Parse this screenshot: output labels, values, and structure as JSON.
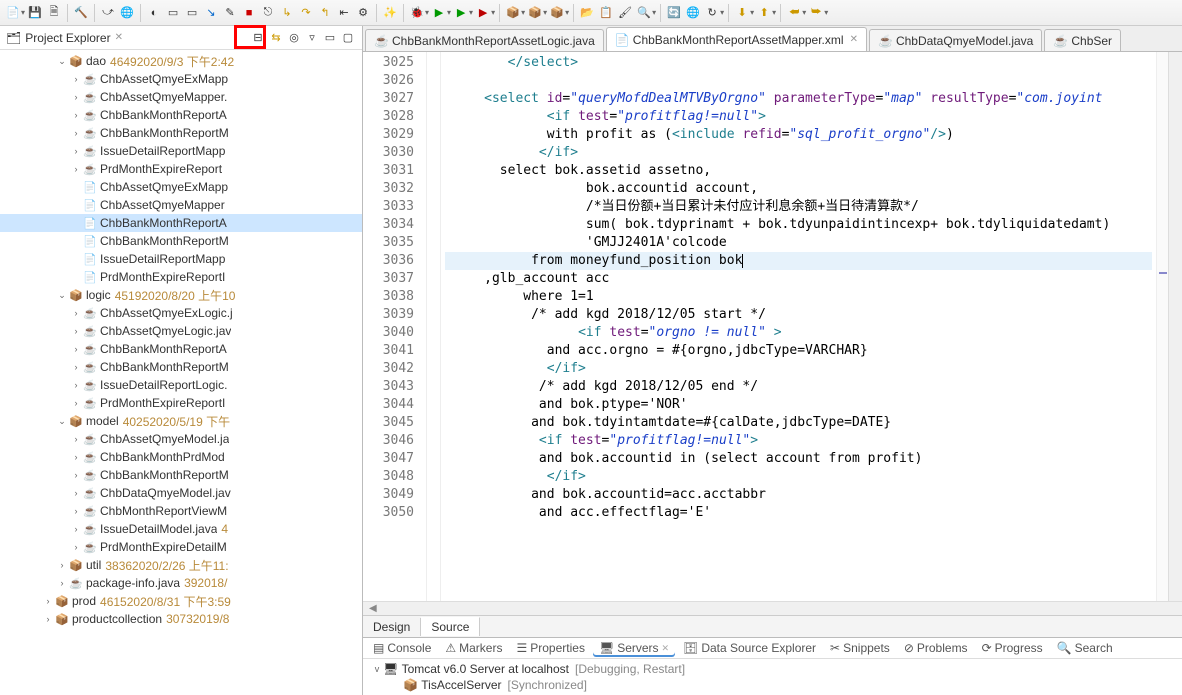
{
  "toolbar_icons": [
    "new",
    "save",
    "save-all",
    "print",
    "build",
    "skip",
    "globe",
    "toggle",
    "panel1",
    "panel2",
    "cursor",
    "edit",
    "stop",
    "redo",
    "next",
    "find",
    "wrench",
    "wand",
    "star",
    "bug",
    "run",
    "ext",
    "pkg",
    "new-pkg",
    "cls",
    "folder",
    "open",
    "brush",
    "sync",
    "web",
    "rotate",
    "down",
    "up",
    "back",
    "fwd"
  ],
  "project_explorer": {
    "title": "Project Explorer",
    "tree": [
      {
        "d": 4,
        "tw": "v",
        "ic": "pk",
        "label": "dao",
        "meta": "46492020/9/3 下午2:42"
      },
      {
        "d": 5,
        "tw": ">",
        "ic": "ju",
        "label": "ChbAssetQmyeExMapp"
      },
      {
        "d": 5,
        "tw": ">",
        "ic": "ju",
        "label": "ChbAssetQmyeMapper."
      },
      {
        "d": 5,
        "tw": ">",
        "ic": "ju",
        "label": "ChbBankMonthReportA"
      },
      {
        "d": 5,
        "tw": ">",
        "ic": "ju",
        "label": "ChbBankMonthReportM"
      },
      {
        "d": 5,
        "tw": ">",
        "ic": "ju",
        "label": "IssueDetailReportMapp"
      },
      {
        "d": 5,
        "tw": ">",
        "ic": "ju",
        "label": "PrdMonthExpireReport"
      },
      {
        "d": 5,
        "tw": "",
        "ic": "xm",
        "label": "ChbAssetQmyeExMapp"
      },
      {
        "d": 5,
        "tw": "",
        "ic": "xm",
        "label": "ChbAssetQmyeMapper"
      },
      {
        "d": 5,
        "tw": "",
        "ic": "xm",
        "label": "ChbBankMonthReportA",
        "sel": true
      },
      {
        "d": 5,
        "tw": "",
        "ic": "xm",
        "label": "ChbBankMonthReportM"
      },
      {
        "d": 5,
        "tw": "",
        "ic": "xm",
        "label": "IssueDetailReportMapp"
      },
      {
        "d": 5,
        "tw": "",
        "ic": "xm",
        "label": "PrdMonthExpireReportI"
      },
      {
        "d": 4,
        "tw": "v",
        "ic": "pk",
        "label": "logic",
        "meta": "45192020/8/20 上午10"
      },
      {
        "d": 5,
        "tw": ">",
        "ic": "ju",
        "label": "ChbAssetQmyeExLogic.j"
      },
      {
        "d": 5,
        "tw": ">",
        "ic": "ju",
        "label": "ChbAssetQmyeLogic.jav"
      },
      {
        "d": 5,
        "tw": ">",
        "ic": "ju",
        "label": "ChbBankMonthReportA"
      },
      {
        "d": 5,
        "tw": ">",
        "ic": "ju",
        "label": "ChbBankMonthReportM"
      },
      {
        "d": 5,
        "tw": ">",
        "ic": "ju",
        "label": "IssueDetailReportLogic."
      },
      {
        "d": 5,
        "tw": ">",
        "ic": "ju",
        "label": "PrdMonthExpireReportI"
      },
      {
        "d": 4,
        "tw": "v",
        "ic": "pk",
        "label": "model",
        "meta": "40252020/5/19 下午"
      },
      {
        "d": 5,
        "tw": ">",
        "ic": "ju",
        "label": "ChbAssetQmyeModel.ja"
      },
      {
        "d": 5,
        "tw": ">",
        "ic": "ju",
        "label": "ChbBankMonthPrdMod"
      },
      {
        "d": 5,
        "tw": ">",
        "ic": "ju",
        "label": "ChbBankMonthReportM"
      },
      {
        "d": 5,
        "tw": ">",
        "ic": "ju",
        "label": "ChbDataQmyeModel.jav"
      },
      {
        "d": 5,
        "tw": ">",
        "ic": "ju",
        "label": "ChbMonthReportViewM"
      },
      {
        "d": 5,
        "tw": ">",
        "ic": "ju",
        "label": "IssueDetailModel.java",
        "meta": "4"
      },
      {
        "d": 5,
        "tw": ">",
        "ic": "ju",
        "label": "PrdMonthExpireDetailM"
      },
      {
        "d": 4,
        "tw": ">",
        "ic": "pk",
        "label": "util",
        "meta": "38362020/2/26 上午11:"
      },
      {
        "d": 4,
        "tw": ">",
        "ic": "ju",
        "label": "package-info.java",
        "meta": "392018/"
      },
      {
        "d": 3,
        "tw": ">",
        "ic": "pk",
        "label": "prod",
        "meta": "46152020/8/31 下午3:59"
      },
      {
        "d": 3,
        "tw": ">",
        "ic": "pk",
        "label": "productcollection",
        "meta": "30732019/8"
      }
    ]
  },
  "editor_tabs": [
    {
      "icon": "java",
      "label": "ChbBankMonthReportAssetLogic.java",
      "active": false
    },
    {
      "icon": "xml",
      "label": "ChbBankMonthReportAssetMapper.xml",
      "active": true
    },
    {
      "icon": "java",
      "label": "ChbDataQmyeModel.java",
      "active": false
    },
    {
      "icon": "java",
      "label": "ChbSer",
      "active": false
    }
  ],
  "code_lines": [
    {
      "n": 3025,
      "html": "        <span class='t-tag'>&lt;/select&gt;</span>"
    },
    {
      "n": 3026,
      "html": ""
    },
    {
      "n": 3027,
      "html": "     <span class='t-tag'>&lt;select</span> <span class='t-attr'>id</span>=<span class='t-str'>\"queryMofdDealMTVByOrgno\"</span> <span class='t-attr'>parameterType</span>=<span class='t-str'>\"map\"</span> <span class='t-attr'>resultType</span>=<span class='t-str'>\"com.joyint</span>"
    },
    {
      "n": 3028,
      "html": "             <span class='t-tag'>&lt;if</span> <span class='t-attr'>test</span>=<span class='t-str'>\"profitflag!=null\"</span><span class='t-tag'>&gt;</span>"
    },
    {
      "n": 3029,
      "html": "             with profit as (<span class='t-tag'>&lt;include</span> <span class='t-attr'>refid</span>=<span class='t-str'>\"sql_profit_orgno\"</span><span class='t-tag'>/&gt;</span>)"
    },
    {
      "n": 3030,
      "html": "            <span class='t-tag'>&lt;/if&gt;</span>"
    },
    {
      "n": 3031,
      "html": "       select bok.assetid assetno,"
    },
    {
      "n": 3032,
      "html": "                  bok.accountid account,"
    },
    {
      "n": 3033,
      "html": "                  /*当日份额+当日累计未付应计利息余额+当日待清算款*/"
    },
    {
      "n": 3034,
      "html": "                  sum( bok.tdyprinamt + bok.tdyunpaidintincexp+ bok.tdyliquidatedamt)"
    },
    {
      "n": 3035,
      "html": "                  'GMJJ2401A'colcode"
    },
    {
      "n": 3036,
      "html": "           from moneyfund_position bok<span class='caret'></span>",
      "hl": true
    },
    {
      "n": 3037,
      "html": "     ,glb_account acc"
    },
    {
      "n": 3038,
      "html": "          where 1=1"
    },
    {
      "n": 3039,
      "html": "           /* add kgd 2018/12/05 start */"
    },
    {
      "n": 3040,
      "html": "                 <span class='t-tag'>&lt;if</span> <span class='t-attr'>test</span>=<span class='t-str'>\"orgno != null\"</span> <span class='t-tag'>&gt;</span>"
    },
    {
      "n": 3041,
      "html": "             and acc.orgno = #{orgno,jdbcType=VARCHAR}"
    },
    {
      "n": 3042,
      "html": "             <span class='t-tag'>&lt;/if&gt;</span>"
    },
    {
      "n": 3043,
      "html": "            /* add kgd 2018/12/05 end */"
    },
    {
      "n": 3044,
      "html": "            and bok.ptype='NOR'"
    },
    {
      "n": 3045,
      "html": "           and bok.tdyintamtdate=#{calDate,jdbcType=DATE}"
    },
    {
      "n": 3046,
      "html": "            <span class='t-tag'>&lt;if</span> <span class='t-attr'>test</span>=<span class='t-str'>\"profitflag!=null\"</span><span class='t-tag'>&gt;</span>"
    },
    {
      "n": 3047,
      "html": "            and bok.accountid in (select account from profit)"
    },
    {
      "n": 3048,
      "html": "             <span class='t-tag'>&lt;/if&gt;</span>"
    },
    {
      "n": 3049,
      "html": "           and bok.accountid=acc.acctabbr"
    },
    {
      "n": 3050,
      "html": "            and acc.effectflag='E'"
    }
  ],
  "design_tabs": {
    "design": "Design",
    "source": "Source"
  },
  "bottom_views": {
    "tabs": [
      "Console",
      "Markers",
      "Properties",
      "Servers",
      "Data Source Explorer",
      "Snippets",
      "Problems",
      "Progress",
      "Search"
    ],
    "active": 3,
    "server_name": "Tomcat v6.0 Server at localhost",
    "server_status": "[Debugging, Restart]",
    "module_name": "TisAccelServer",
    "module_status": "[Synchronized]"
  }
}
